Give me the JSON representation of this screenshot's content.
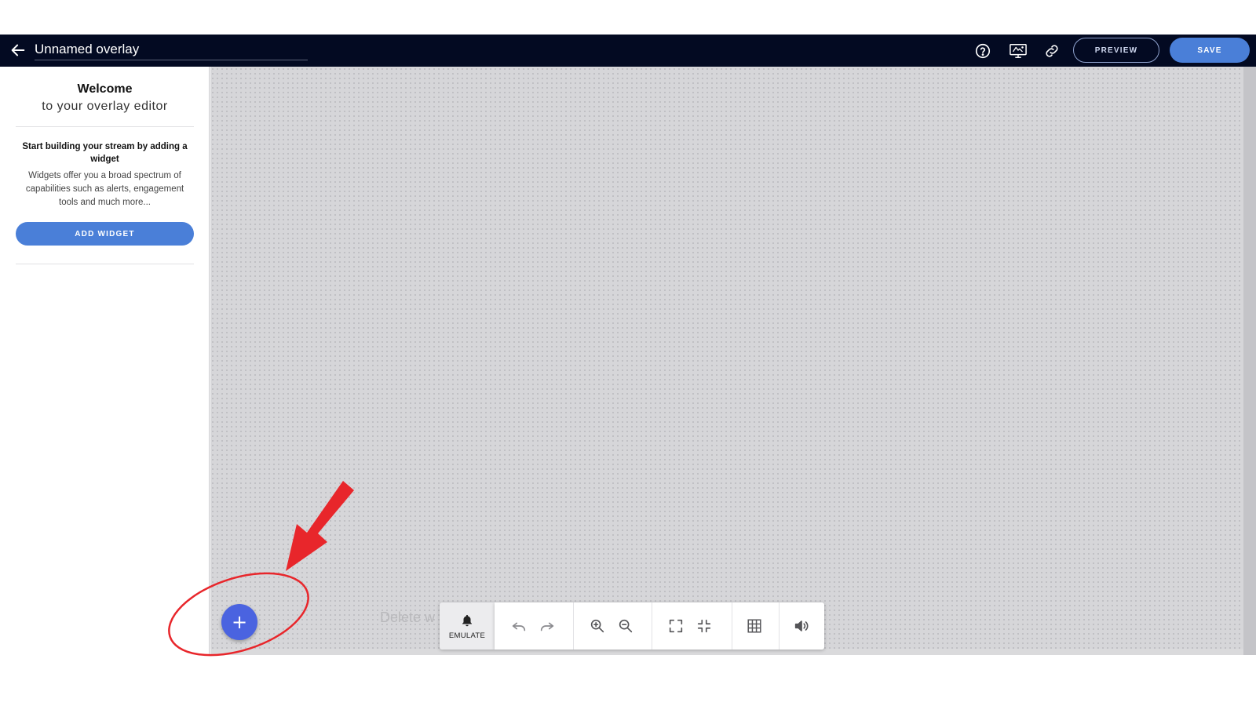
{
  "header": {
    "overlay_name": "Unnamed overlay",
    "preview_label": "PREVIEW",
    "save_label": "SAVE",
    "icons": [
      "back-arrow-icon",
      "help-icon",
      "monitor-icon",
      "link-icon"
    ]
  },
  "sidebar": {
    "welcome_title": "Welcome",
    "welcome_subtitle": "to your overlay editor",
    "start_title": "Start building your stream by adding a widget",
    "start_description": "Widgets offer you a broad spectrum of capabilities such as alerts, engagement tools and much more...",
    "add_widget_label": "ADD WIDGET"
  },
  "canvas": {
    "delete_hint": "Delete w",
    "add_button_label": "+"
  },
  "toolbar": {
    "emulate_label": "EMULATE",
    "tools": [
      "undo-icon",
      "redo-icon",
      "zoom-in-icon",
      "zoom-out-icon",
      "fullscreen-icon",
      "exit-fullscreen-icon",
      "grid-icon",
      "volume-icon"
    ]
  },
  "colors": {
    "header_bg": "#030a22",
    "accent_blue": "#4a7fd8",
    "fab_blue": "#4a63e0",
    "annotation_red": "#e8262b"
  }
}
